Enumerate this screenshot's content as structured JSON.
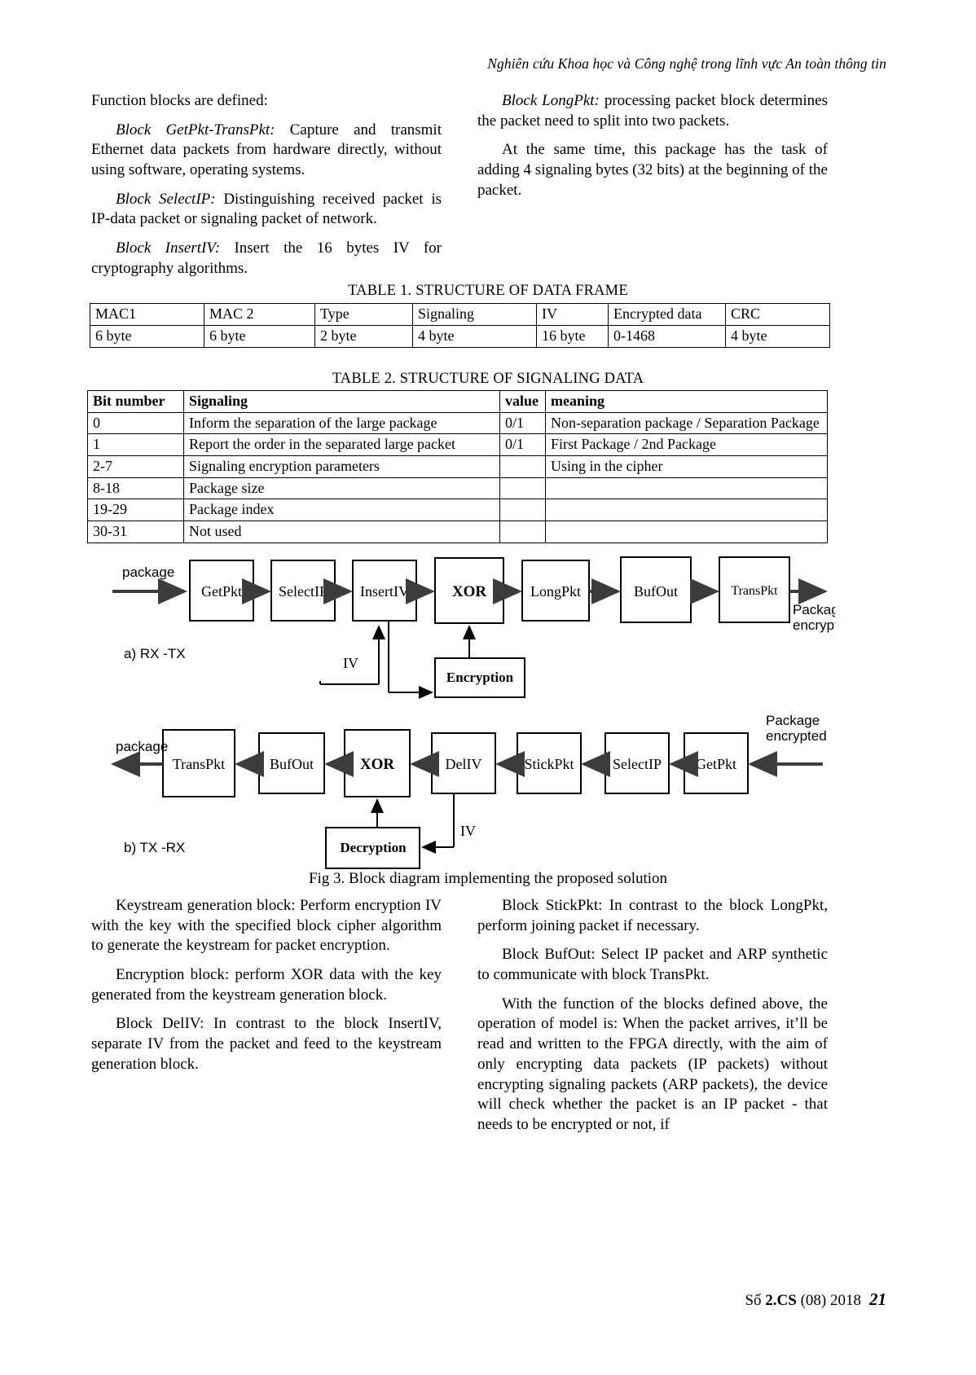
{
  "running_head": "Nghiên cứu Khoa học và Công nghệ trong lĩnh vực An toàn thông tin",
  "left_column_top": [
    {
      "lead": "",
      "text": "Function blocks are defined:"
    },
    {
      "lead": "Block GetPkt-TransPkt:",
      "text": " Capture and transmit Ethernet data packets from hardware directly, without using software, operating systems."
    },
    {
      "lead": "Block SelectIP:",
      "text": " Distinguishing received packet is IP-data packet or signaling packet of network."
    },
    {
      "lead": "Block InsertIV:",
      "text": " Insert the 16 bytes IV for cryptography algorithms."
    }
  ],
  "right_column_top": [
    {
      "lead": "Block LongPkt:",
      "text": " processing packet block determines the packet need to split into two packets."
    },
    {
      "lead": "",
      "text": "At the same time, this package has the task of adding 4 signaling bytes (32 bits) at the beginning of the packet."
    }
  ],
  "table1": {
    "caption": "TABLE 1. STRUCTURE OF DATA FRAME",
    "rows": [
      [
        "MAC1",
        "MAC 2",
        "Type",
        "Signaling",
        "IV",
        "Encrypted data",
        "CRC"
      ],
      [
        "6 byte",
        "6 byte",
        "2 byte",
        "4 byte",
        "16 byte",
        "0-1468",
        "4 byte"
      ]
    ]
  },
  "table2": {
    "caption": "TABLE 2. STRUCTURE OF SIGNALING DATA",
    "headers": [
      "Bit number",
      "Signaling",
      "value",
      "meaning"
    ],
    "rows": [
      [
        "0",
        "Inform the separation of the large package",
        "0/1",
        "Non-separation package / Separation Package"
      ],
      [
        "1",
        "Report the order in the separated large packet",
        "0/1",
        "First Package / 2nd Package"
      ],
      [
        "2-7",
        "Signaling encryption parameters",
        "",
        "Using in the cipher"
      ],
      [
        "8-18",
        "Package size",
        "",
        ""
      ],
      [
        "19-29",
        "Package index",
        "",
        ""
      ],
      [
        "30-31",
        "Not used",
        "",
        ""
      ]
    ]
  },
  "figure": {
    "caption": "Fig 3. Block diagram implementing the proposed solution",
    "diagram_a": {
      "label": "a) RX -TX",
      "input_label": "package",
      "output_label_line1": "Package",
      "output_label_line2": "encrypted",
      "blocks": [
        "GetPkt",
        "SelectIP",
        "InsertIV",
        "XOR",
        "LongPkt",
        "BufOut",
        "TransPkt"
      ],
      "aux_block": "Encryption",
      "iv_label": "IV"
    },
    "diagram_b": {
      "label": "b) TX -RX",
      "input_label_line1": "Package",
      "input_label_line2": "encrypted",
      "output_label": "package",
      "blocks": [
        "TransPkt",
        "BufOut",
        "XOR",
        "DelIV",
        "StickPkt",
        "SelectIP",
        "GetPkt"
      ],
      "aux_block": "Decryption",
      "iv_label": "IV"
    }
  },
  "left_column_bottom": [
    {
      "lead": "",
      "text": "Keystream generation block: Perform encryption IV with the key with the specified block cipher algorithm to generate the keystream for packet encryption."
    },
    {
      "lead": "",
      "text": "Encryption block: perform XOR data with the key generated from the keystream generation block."
    },
    {
      "lead": "",
      "text": "Block DelIV: In contrast to the block InsertIV, separate IV from the packet and feed to the keystream generation block."
    }
  ],
  "right_column_bottom": [
    {
      "lead": "",
      "text": "Block StickPkt: In contrast to the block LongPkt, perform joining packet if necessary."
    },
    {
      "lead": "",
      "text": "Block BufOut: Select IP packet and ARP synthetic to communicate with block TransPkt."
    },
    {
      "lead": "",
      "text": "With the function of the blocks defined above, the operation of model is: When the packet arrives, it’ll be read and written to the FPGA directly, with the aim of only encrypting data packets (IP packets)  without encrypting signaling packets (ARP packets), the device will check whether the packet is an IP packet - that needs to be encrypted or not, if"
    }
  ],
  "footer": {
    "prefix": "Số ",
    "issue": "2.CS",
    "suffix": " (08) 2018",
    "page": "21"
  }
}
